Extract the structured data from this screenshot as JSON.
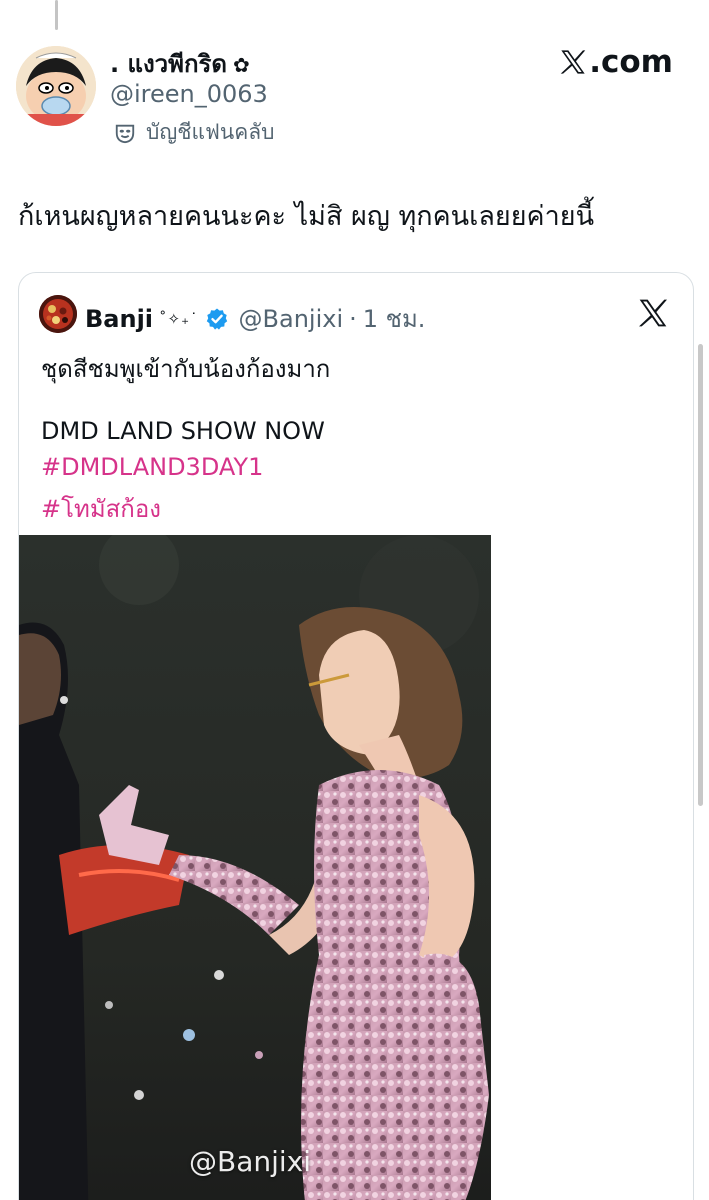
{
  "post": {
    "display_name": ". แงวพีกริด",
    "name_symbol": "✿",
    "handle": "@ireen_0063",
    "badge_label": "บัญชีแฟนคลับ",
    "text": "ก้เหนผญหลายคนนะคะ ไม่สิ ผญ ทุกคนเลยยค่ายนี้",
    "site_label": ".com",
    "icons": {
      "avatar": "cartoon-avatar-icon",
      "badge": "mask-icon",
      "site": "x-logo-icon"
    }
  },
  "quote": {
    "name": "Banji",
    "sparkle": "˚✧₊˙",
    "handle": "@Banjixi",
    "separator": "·",
    "time": "1 ชม.",
    "text": "ชุดสีชมพูเข้ากับน้องก้องมาก",
    "line2": "DMD LAND SHOW NOW",
    "hashtags": [
      "#DMDLAND3DAY1",
      "#โทมัสก้อง"
    ],
    "media_watermark": "@Banjixi",
    "icons": {
      "avatar": "food-avatar-icon",
      "verified": "verified-badge-icon",
      "corner": "x-logo-icon"
    }
  },
  "colors": {
    "hashtag": "#d6338a",
    "verified": "#1d9bf0",
    "secondary_text": "#536471"
  }
}
